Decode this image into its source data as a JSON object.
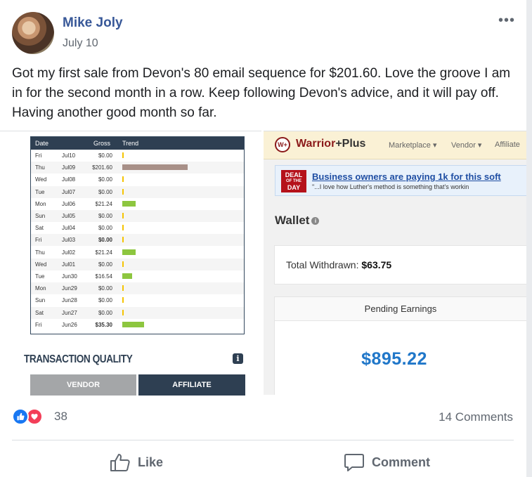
{
  "post": {
    "author": "Mike Joly",
    "date": "July 10",
    "more_label": "•••",
    "text": "Got my first sale from Devon's 80 email sequence for $201.60. Love the groove I am in for the second month in a row. Keep following Devon's advice, and it will pay off. Having another good month so far."
  },
  "sales_table": {
    "headers": {
      "date": "Date",
      "gross": "Gross",
      "trend": "Trend"
    },
    "rows": [
      {
        "day": "Fri",
        "date": "Jul10",
        "gross": "$0.00",
        "trend": 0
      },
      {
        "day": "Thu",
        "date": "Jul09",
        "gross": "$201.60",
        "trend": 201.6
      },
      {
        "day": "Wed",
        "date": "Jul08",
        "gross": "$0.00",
        "trend": 0
      },
      {
        "day": "Tue",
        "date": "Jul07",
        "gross": "$0.00",
        "trend": 0
      },
      {
        "day": "Mon",
        "date": "Jul06",
        "gross": "$21.24",
        "trend": 21.24
      },
      {
        "day": "Sun",
        "date": "Jul05",
        "gross": "$0.00",
        "trend": 0
      },
      {
        "day": "Sat",
        "date": "Jul04",
        "gross": "$0.00",
        "trend": 0
      },
      {
        "day": "Fri",
        "date": "Jul03",
        "gross": "$0.00",
        "trend": 0
      },
      {
        "day": "Thu",
        "date": "Jul02",
        "gross": "$21.24",
        "trend": 21.24
      },
      {
        "day": "Wed",
        "date": "Jul01",
        "gross": "$0.00",
        "trend": 0
      },
      {
        "day": "Tue",
        "date": "Jun30",
        "gross": "$16.54",
        "trend": 16.54
      },
      {
        "day": "Mon",
        "date": "Jun29",
        "gross": "$0.00",
        "trend": 0
      },
      {
        "day": "Sun",
        "date": "Jun28",
        "gross": "$0.00",
        "trend": 0
      },
      {
        "day": "Sat",
        "date": "Jun27",
        "gross": "$0.00",
        "trend": 0
      },
      {
        "day": "Fri",
        "date": "Jun26",
        "gross": "$35.30",
        "trend": 35.3
      }
    ],
    "bar_colors": {
      "highlight": "#a89088",
      "normal": "#8dc63f",
      "zero": "#f5c400"
    },
    "transaction_quality": "TRANSACTION QUALITY",
    "info_label": "i",
    "tab_vendor": "VENDOR",
    "tab_affiliate": "AFFILIATE"
  },
  "warrior": {
    "logo": "W+",
    "brand": "Warrior",
    "brand_plus": "+Plus",
    "nav": [
      "Marketplace ▾",
      "Vendor ▾",
      "Affiliate"
    ],
    "deal_badge_lines": [
      "DEAL",
      "OF THE",
      "DAY"
    ],
    "deal_title": "Business owners are paying 1k for this soft",
    "deal_quote": "\"...I love how Luther's method is something that's workin",
    "wallet_label": "Wallet",
    "wallet_info": "i",
    "withdrawn_label": "Total Withdrawn:",
    "withdrawn_value": "$63.75",
    "pending_label": "Pending Earnings",
    "pending_value": "$895.22"
  },
  "engagement": {
    "reaction_count": "38",
    "comments": "14 Comments",
    "like_label": "Like",
    "comment_label": "Comment"
  },
  "colors": {
    "author": "#385898",
    "like_blue": "#1877f2",
    "love_red": "#f33e58",
    "pending_blue": "#2077c9"
  }
}
